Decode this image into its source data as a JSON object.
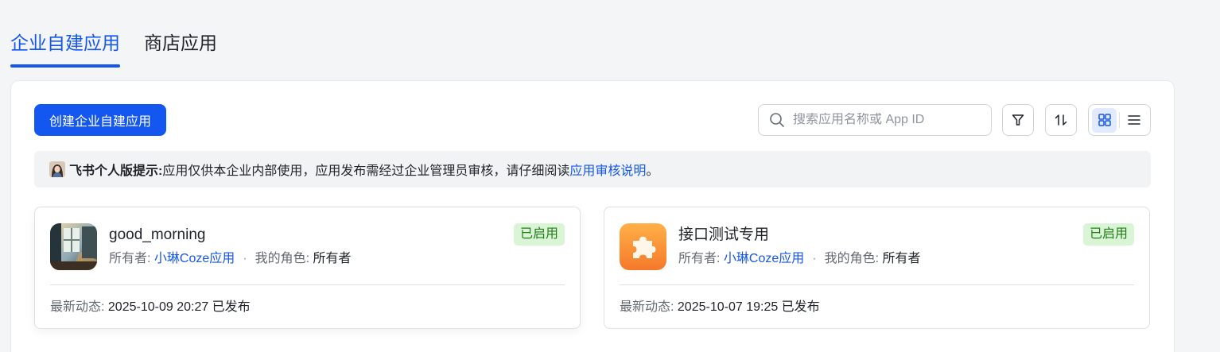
{
  "tabs": [
    {
      "label": "企业自建应用",
      "active": true
    },
    {
      "label": "商店应用",
      "active": false
    }
  ],
  "toolbar": {
    "create_label": "创建企业自建应用",
    "search_placeholder": "搜索应用名称或 App ID",
    "search_value": "",
    "filter_icon": "filter-icon",
    "sort_icon": "sort-icon",
    "view_mode": "grid"
  },
  "notice": {
    "title": "飞书个人版提示:",
    "text": "应用仅供本企业内部使用，应用发布需经过企业管理员审核，请仔细阅读",
    "link": "应用审核说明",
    "end": "。"
  },
  "apps": [
    {
      "name": "good_morning",
      "owner_label": "所有者:",
      "owner": "小琳Coze应用",
      "dot": "·",
      "role_label": "我的角色:",
      "role": "所有者",
      "status": "已启用",
      "activity_label": "最新动态:",
      "activity": "2025-10-09 20:27 已发布"
    },
    {
      "name": "接口测试专用",
      "owner_label": "所有者:",
      "owner": "小琳Coze应用",
      "dot": "·",
      "role_label": "我的角色:",
      "role": "所有者",
      "status": "已启用",
      "activity_label": "最新动态:",
      "activity": "2025-10-07 19:25 已发布"
    }
  ],
  "colors": {
    "accent": "#1456f0",
    "status_bg": "#d9f5d6",
    "status_text": "#237b19"
  }
}
